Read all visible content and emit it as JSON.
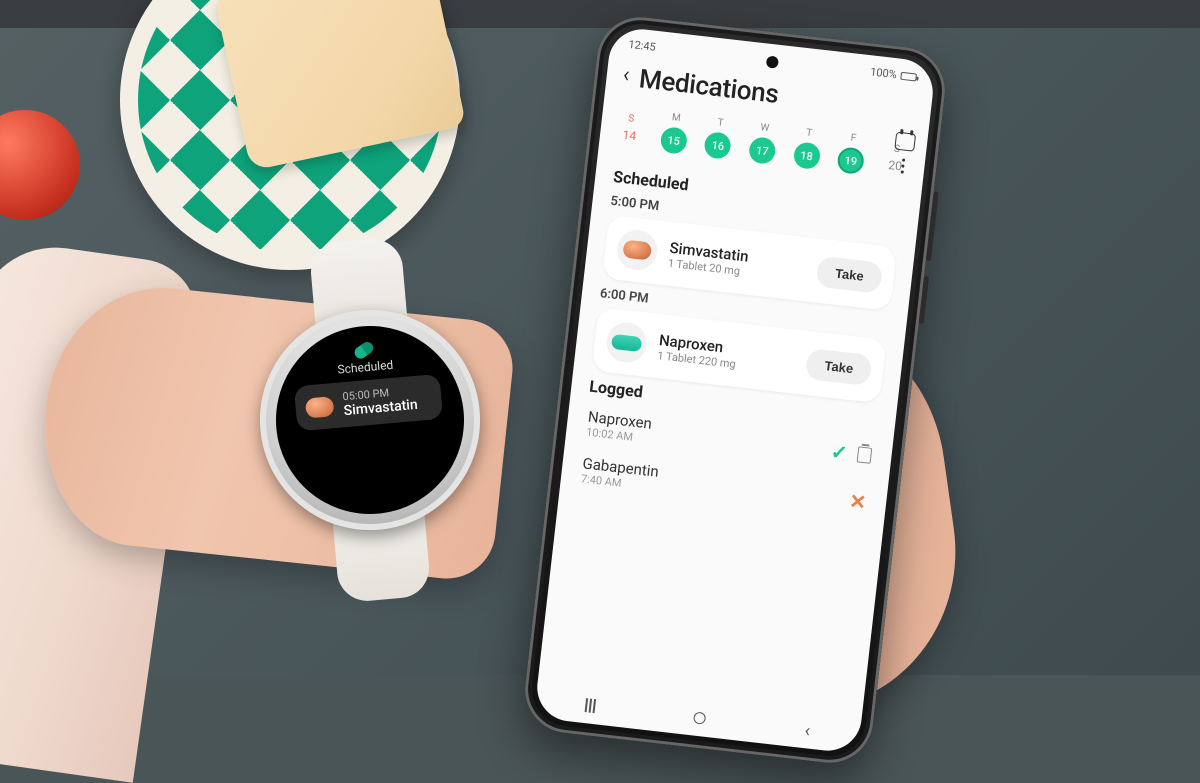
{
  "phone": {
    "status": {
      "time": "12:45",
      "battery_text": "100%"
    },
    "header": {
      "title": "Medications"
    },
    "week": {
      "days": [
        {
          "dow": "S",
          "num": "14"
        },
        {
          "dow": "M",
          "num": "15"
        },
        {
          "dow": "T",
          "num": "16"
        },
        {
          "dow": "W",
          "num": "17"
        },
        {
          "dow": "T",
          "num": "18"
        },
        {
          "dow": "F",
          "num": "19"
        },
        {
          "dow": "S",
          "num": "20"
        }
      ]
    },
    "sections": {
      "scheduled_label": "Scheduled",
      "logged_label": "Logged"
    },
    "scheduled": [
      {
        "time": "5:00 PM",
        "name": "Simvastatin",
        "dose": "1 Tablet 20 mg",
        "action": "Take",
        "icon": "pill-orange"
      },
      {
        "time": "6:00 PM",
        "name": "Naproxen",
        "dose": "1 Tablet 220 mg",
        "action": "Take",
        "icon": "pill-teal"
      }
    ],
    "logged": [
      {
        "name": "Naproxen",
        "time": "10:02 AM",
        "status": "taken"
      },
      {
        "name": "Gabapentin",
        "time": "7:40 AM",
        "status": "skipped"
      }
    ]
  },
  "watch": {
    "heading": "Scheduled",
    "time": "05:00 PM",
    "med": "Simvastatin"
  }
}
